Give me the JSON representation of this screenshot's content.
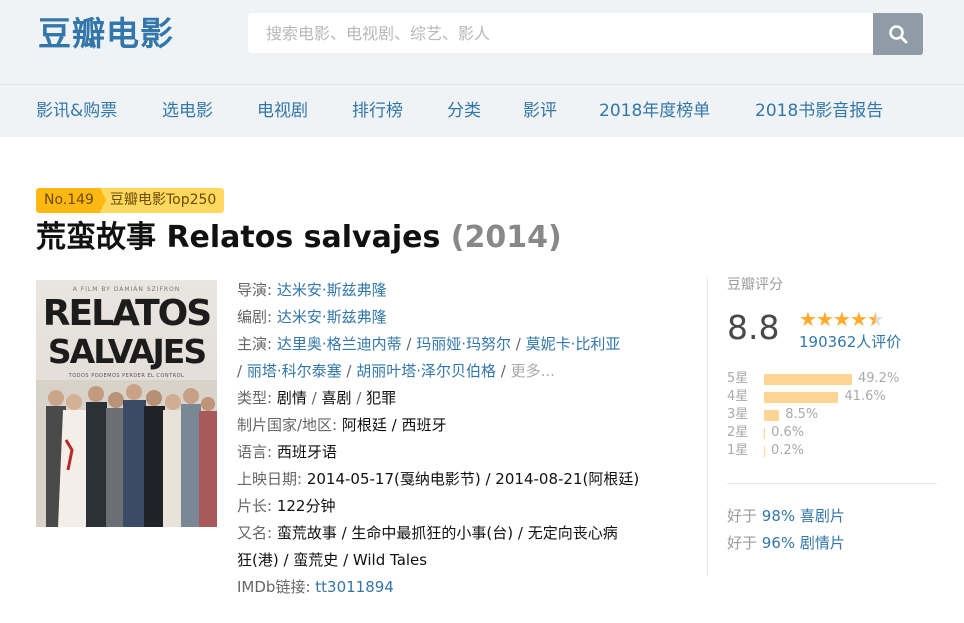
{
  "header": {
    "logo": "豆瓣电影",
    "search_placeholder": "搜索电影、电视剧、综艺、影人",
    "search_icon": "search-icon"
  },
  "nav": {
    "items": [
      {
        "label": "影讯&购票"
      },
      {
        "label": "选电影"
      },
      {
        "label": "电视剧"
      },
      {
        "label": "排行榜"
      },
      {
        "label": "分类"
      },
      {
        "label": "影评"
      },
      {
        "label": "2018年度榜单"
      },
      {
        "label": "2018书影音报告"
      }
    ]
  },
  "rank": {
    "number": "No.149",
    "label": "豆瓣电影Top250"
  },
  "movie": {
    "title": "荒蛮故事 Relatos salvajes",
    "year": "(2014)",
    "poster": {
      "director_credit": "A FILM BY DAMIÁN SZIFRON",
      "title_line1": "RELATOS",
      "title_line2": "SALVAJES",
      "tagline": "TODOS PODEMOS PERDER EL CONTROL"
    }
  },
  "info": {
    "director_label": "导演:",
    "director": "达米安·斯兹弗隆",
    "writer_label": "编剧:",
    "writer": "达米安·斯兹弗隆",
    "cast_label": "主演:",
    "cast": [
      "达里奥·格兰迪内蒂",
      "玛丽娅·玛努尔",
      "莫妮卡·比利亚",
      "丽塔·科尔泰塞",
      "胡丽叶塔·泽尔贝伯格"
    ],
    "sep": " / ",
    "more": "更多...",
    "genre_label": "类型:",
    "genres": [
      "剧情",
      "喜剧",
      "犯罪"
    ],
    "country_label": "制片国家/地区:",
    "country": "阿根廷 / 西班牙",
    "language_label": "语言:",
    "language": "西班牙语",
    "release_label": "上映日期:",
    "release": "2014-05-17(戛纳电影节) / 2014-08-21(阿根廷)",
    "runtime_label": "片长:",
    "runtime": "122分钟",
    "aka_label": "又名:",
    "aka_line1": "蛮荒故事 / 生命中最抓狂的小事(台) / 无定向丧心病",
    "aka_line2": "狂(港) / 蛮荒史 / Wild Tales",
    "imdb_label": "IMDb链接:",
    "imdb": "tt3011894"
  },
  "rating": {
    "label": "豆瓣评分",
    "score": "8.8",
    "stars_value": 4.5,
    "votes": "190362人评价",
    "distribution": [
      {
        "label": "5星",
        "percent": 49.2,
        "text": "49.2%"
      },
      {
        "label": "4星",
        "percent": 41.6,
        "text": "41.6%"
      },
      {
        "label": "3星",
        "percent": 8.5,
        "text": "8.5%"
      },
      {
        "label": "2星",
        "percent": 0.6,
        "text": "0.6%"
      },
      {
        "label": "1星",
        "percent": 0.2,
        "text": "0.2%"
      }
    ],
    "better_than": [
      {
        "prefix": "好于",
        "value": "98% 喜剧片"
      },
      {
        "prefix": "好于",
        "value": "96% 剧情片"
      }
    ]
  },
  "colors": {
    "brand": "#3377aa",
    "star": "#ffac2d",
    "bar": "#ffd596",
    "badge_dark": "#ffb712",
    "badge_light": "#ffd95f"
  }
}
